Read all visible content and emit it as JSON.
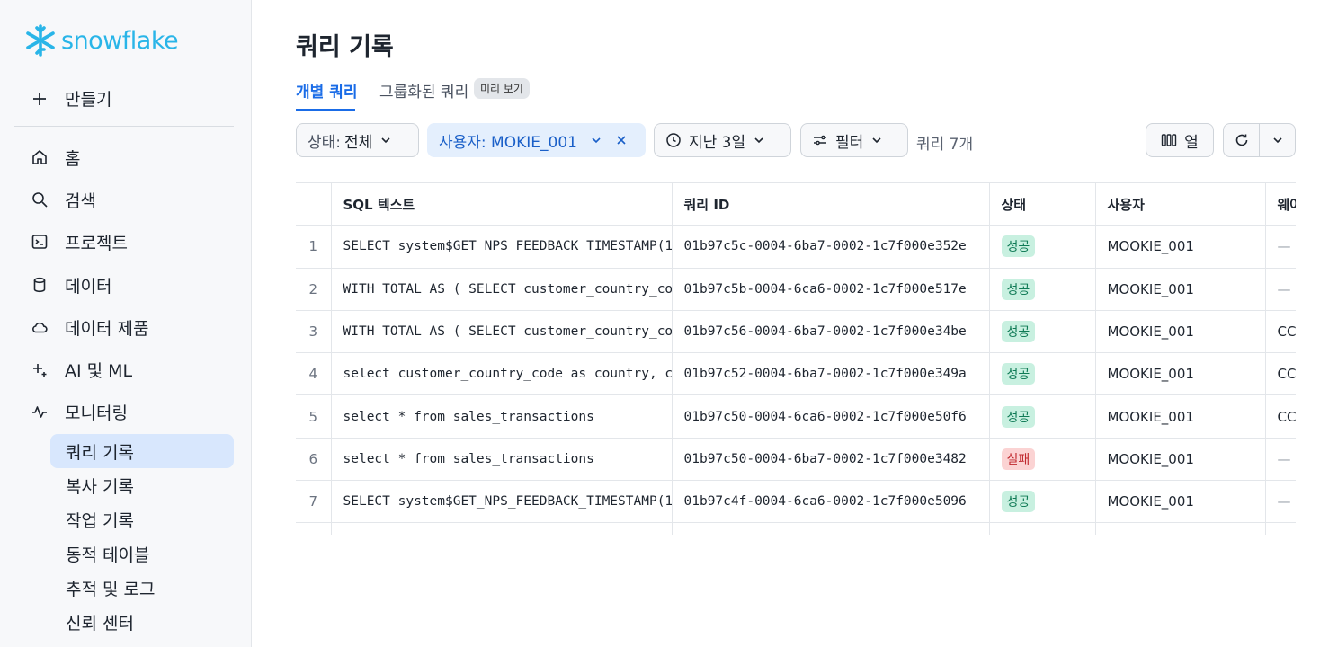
{
  "brand": {
    "name": "snowflake"
  },
  "sidebar": {
    "create_label": "만들기",
    "items": [
      {
        "label": "홈",
        "icon": "home-icon"
      },
      {
        "label": "검색",
        "icon": "search-icon"
      },
      {
        "label": "프로젝트",
        "icon": "terminal-icon"
      },
      {
        "label": "데이터",
        "icon": "database-icon"
      },
      {
        "label": "데이터 제품",
        "icon": "cloud-icon"
      },
      {
        "label": "AI 및 ML",
        "icon": "sparkle-icon"
      },
      {
        "label": "모니터링",
        "icon": "activity-icon"
      }
    ],
    "sub_items": [
      {
        "label": "쿼리 기록",
        "active": true
      },
      {
        "label": "복사 기록"
      },
      {
        "label": "작업 기록"
      },
      {
        "label": "동적 테이블"
      },
      {
        "label": "추적 및 로그"
      },
      {
        "label": "신뢰 센터"
      }
    ]
  },
  "page": {
    "title": "쿼리 기록",
    "tabs": [
      {
        "label": "개별 쿼리",
        "active": true
      },
      {
        "label": "그룹화된 쿼리",
        "badge": "미리 보기"
      }
    ]
  },
  "filters": {
    "status_prefix": "상태:",
    "status_value": "전체",
    "user_chip": "사용자: MOKIE_001",
    "time_chip": "지난 3일",
    "filter_chip": "필터",
    "count": "쿼리 7개"
  },
  "toolbar": {
    "columns_label": "열"
  },
  "table": {
    "columns": [
      "SQL 텍스트",
      "쿼리 ID",
      "상태",
      "사용자",
      "웨어"
    ],
    "rows": [
      {
        "n": "1",
        "sql": "SELECT system$GET_NPS_FEEDBACK_TIMESTAMP(1",
        "id": "01b97c5c-0004-6ba7-0002-1c7f000e352e",
        "status": "성공",
        "ok": true,
        "user": "MOOKIE_001",
        "wh": "—"
      },
      {
        "n": "2",
        "sql": "WITH TOTAL AS ( SELECT customer_country_code",
        "id": "01b97c5b-0004-6ca6-0002-1c7f000e517e",
        "status": "성공",
        "ok": true,
        "user": "MOOKIE_001",
        "wh": "—"
      },
      {
        "n": "3",
        "sql": "WITH TOTAL AS ( SELECT customer_country_code",
        "id": "01b97c56-0004-6ba7-0002-1c7f000e34be",
        "status": "성공",
        "ok": true,
        "user": "MOOKIE_001",
        "wh": "CC"
      },
      {
        "n": "4",
        "sql": "select customer_country_code as country, c",
        "id": "01b97c52-0004-6ba7-0002-1c7f000e349a",
        "status": "성공",
        "ok": true,
        "user": "MOOKIE_001",
        "wh": "CC"
      },
      {
        "n": "5",
        "sql": "select * from sales_transactions",
        "id": "01b97c50-0004-6ca6-0002-1c7f000e50f6",
        "status": "성공",
        "ok": true,
        "user": "MOOKIE_001",
        "wh": "CC"
      },
      {
        "n": "6",
        "sql": "select * from sales_transactions",
        "id": "01b97c50-0004-6ba7-0002-1c7f000e3482",
        "status": "실패",
        "ok": false,
        "user": "MOOKIE_001",
        "wh": "—"
      },
      {
        "n": "7",
        "sql": "SELECT system$GET_NPS_FEEDBACK_TIMESTAMP(1",
        "id": "01b97c4f-0004-6ca6-0002-1c7f000e5096",
        "status": "성공",
        "ok": true,
        "user": "MOOKIE_001",
        "wh": "—"
      }
    ]
  },
  "colors": {
    "accent": "#1a6ce7",
    "brand": "#29b5e8",
    "success_bg": "#c8f0e0",
    "fail_bg": "#fbd3d3"
  }
}
